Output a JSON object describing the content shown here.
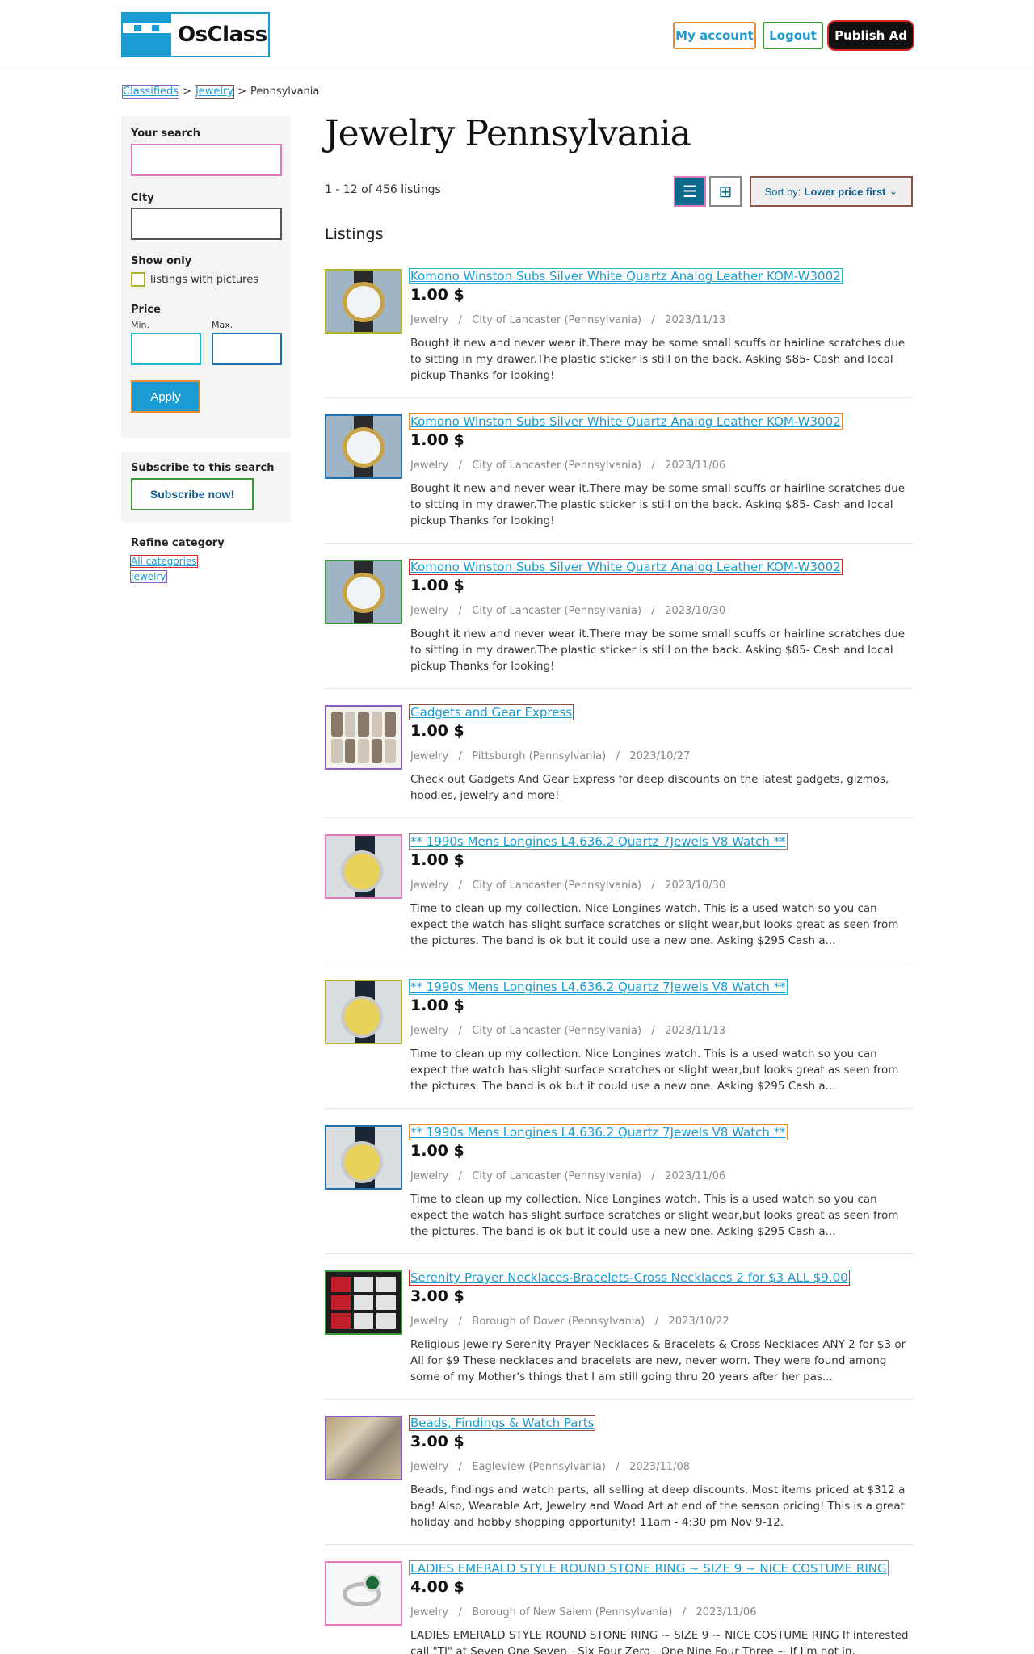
{
  "header": {
    "logo": "OsClass",
    "my_account": "My account",
    "logout": "Logout",
    "publish": "Publish Ad"
  },
  "breadcrumb": {
    "home": "Classifieds",
    "sep1": ">",
    "category": "Jewelry",
    "sep2": ">",
    "current": "Pennsylvania"
  },
  "sidebar": {
    "search_label": "Your search",
    "search_value": "",
    "city_label": "City",
    "city_value": "",
    "show_only_label": "Show only",
    "pictures_label": "listings with pictures",
    "price_label": "Price",
    "min_label": "Min.",
    "max_label": "Max.",
    "apply": "Apply",
    "subscribe_title": "Subscribe to this search",
    "subscribe_button": "Subscribe now!",
    "refine_title": "Refine category",
    "refine_all": "All categories",
    "refine_jewelry": "Jewelry"
  },
  "main": {
    "title": "Jewelry Pennsylvania",
    "count": "1 - 12 of 456 listings",
    "sort_prefix": "Sort by:",
    "sort_value": "Lower price first",
    "listings_heading": "Listings"
  },
  "listings": [
    {
      "title": "Komono Winston Subs Silver White Quartz Analog Leather KOM-W3002",
      "price": "1.00 $",
      "meta": "Jewelry   /   City of Lancaster (Pennsylvania)   /   2023/11/13",
      "desc": "Bought it new and never wear it.There may be some small scuffs or hairline scratches due to sitting in my drawer.The plastic sticker is still on the back. Asking $85- Cash and local pickup Thanks for looking!",
      "img": "watch-white"
    },
    {
      "title": "Komono Winston Subs Silver White Quartz Analog Leather KOM-W3002",
      "price": "1.00 $",
      "meta": "Jewelry   /   City of Lancaster (Pennsylvania)   /   2023/11/06",
      "desc": "Bought it new and never wear it.There may be some small scuffs or hairline scratches due to sitting in my drawer.The plastic sticker is still on the back. Asking $85- Cash and local pickup Thanks for looking!",
      "img": "watch-white"
    },
    {
      "title": "Komono Winston Subs Silver White Quartz Analog Leather KOM-W3002",
      "price": "1.00 $",
      "meta": "Jewelry   /   City of Lancaster (Pennsylvania)   /   2023/10/30",
      "desc": "Bought it new and never wear it.There may be some small scuffs or hairline scratches due to sitting in my drawer.The plastic sticker is still on the back. Asking $85- Cash and local pickup Thanks for looking!",
      "img": "watch-white"
    },
    {
      "title": "Gadgets and Gear Express",
      "price": "1.00 $",
      "meta": "Jewelry   /   Pittsburgh (Pennsylvania)   /   2023/10/27",
      "desc": "Check out Gadgets And Gear Express for deep discounts on the latest gadgets, gizmos, hoodies, jewelry and more!",
      "img": "gadgets"
    },
    {
      "title": "** 1990s Mens Longines L4.636.2 Quartz 7Jewels V8 Watch **",
      "price": "1.00 $",
      "meta": "Jewelry   /   City of Lancaster (Pennsylvania)   /   2023/10/30",
      "desc": "Time to clean up my collection. Nice Longines watch. This is a used watch so you can expect the watch has slight surface scratches or slight wear,but looks great as seen from the pictures. The band is ok but it could use a new one. Asking $295 Cash a...",
      "img": "watch-gold"
    },
    {
      "title": "** 1990s Mens Longines L4.636.2 Quartz 7Jewels V8 Watch **",
      "price": "1.00 $",
      "meta": "Jewelry   /   City of Lancaster (Pennsylvania)   /   2023/11/13",
      "desc": "Time to clean up my collection. Nice Longines watch. This is a used watch so you can expect the watch has slight surface scratches or slight wear,but looks great as seen from the pictures. The band is ok but it could use a new one. Asking $295 Cash a...",
      "img": "watch-gold"
    },
    {
      "title": "** 1990s Mens Longines L4.636.2 Quartz 7Jewels V8 Watch **",
      "price": "1.00 $",
      "meta": "Jewelry   /   City of Lancaster (Pennsylvania)   /   2023/11/06",
      "desc": "Time to clean up my collection. Nice Longines watch. This is a used watch so you can expect the watch has slight surface scratches or slight wear,but looks great as seen from the pictures. The band is ok but it could use a new one. Asking $295 Cash a...",
      "img": "watch-gold"
    },
    {
      "title": "Serenity Prayer Necklaces-Bracelets-Cross Necklaces 2 for $3 ALL $9.00",
      "price": "3.00 $",
      "meta": "Jewelry   /   Borough of Dover (Pennsylvania)   /   2023/10/22",
      "desc": "Religious Jewelry Serenity Prayer Necklaces & Bracelets & Cross Necklaces ANY 2 for $3 or All for $9 These necklaces and bracelets are new, never worn. They were found among some of my Mother's things that I am still going thru 20 years after her pas...",
      "img": "necklace"
    },
    {
      "title": "Beads, Findings & Watch Parts",
      "price": "3.00 $",
      "meta": "Jewelry   /   Eagleview (Pennsylvania)   /   2023/11/08",
      "desc": "Beads, findings and watch parts, all selling at deep discounts. Most items priced at $312 a bag! Also, Wearable Art, Jewelry and Wood Art at end of the season pricing! This is a great holiday and hobby shopping opportunity! 11am - 4:30 pm Nov 9-12.",
      "img": "beads"
    },
    {
      "title": "LADIES EMERALD STYLE ROUND STONE RING ~ SIZE 9 ~ NICE COSTUME RING",
      "price": "4.00 $",
      "meta": "Jewelry   /   Borough of New Salem (Pennsylvania)   /   2023/11/06",
      "desc": "LADIES EMERALD STYLE ROUND STONE RING ~ SIZE 9 ~ NICE COSTUME RING If interested call \"TJ\" at Seven One Seven - Six Four Zero - One Nine Four Three ~ If I'm not in,",
      "img": "ring"
    }
  ]
}
